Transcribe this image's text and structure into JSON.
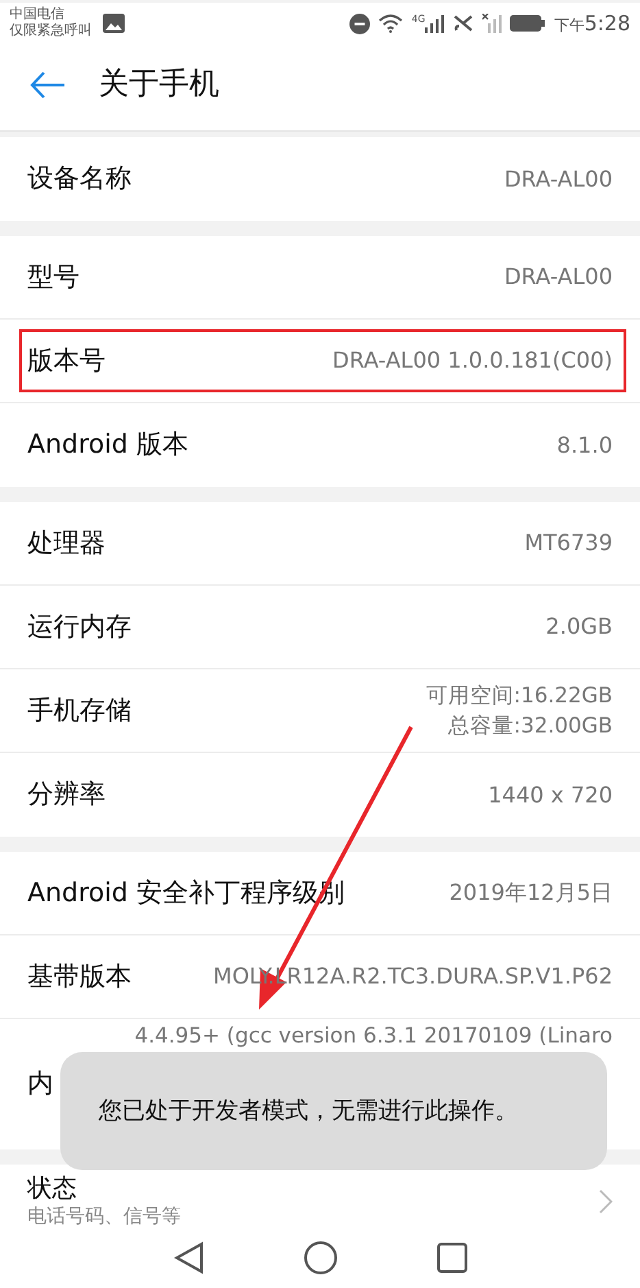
{
  "status_bar": {
    "carrier_lines": [
      "中国电信",
      "仅限紧急呼叫"
    ],
    "time_prefix": "下午",
    "time": "5:28",
    "network": "4G"
  },
  "header": {
    "title": "关于手机"
  },
  "sections": [
    {
      "rows": [
        {
          "kind": "info",
          "label": "设备名称",
          "values": [
            "DRA-AL00"
          ],
          "highlighted": false
        }
      ]
    },
    {
      "rows": [
        {
          "kind": "info",
          "label": "型号",
          "values": [
            "DRA-AL00"
          ],
          "highlighted": false
        },
        {
          "kind": "info",
          "label": "版本号",
          "values": [
            "DRA-AL00 1.0.0.181(C00)"
          ],
          "highlighted": true
        },
        {
          "kind": "info",
          "label": "Android 版本",
          "values": [
            "8.1.0"
          ],
          "highlighted": false
        }
      ]
    },
    {
      "rows": [
        {
          "kind": "info",
          "label": "处理器",
          "values": [
            "MT6739"
          ],
          "highlighted": false
        },
        {
          "kind": "info",
          "label": "运行内存",
          "values": [
            "2.0GB"
          ],
          "highlighted": false
        },
        {
          "kind": "info",
          "label": "手机存储",
          "values": [
            "可用空间:16.22GB",
            "总容量:32.00GB"
          ],
          "highlighted": false
        },
        {
          "kind": "info",
          "label": "分辨率",
          "values": [
            "1440 x 720"
          ],
          "highlighted": false
        }
      ]
    },
    {
      "rows": [
        {
          "kind": "info",
          "label": "Android 安全补丁程序级别",
          "values": [
            "2019年12月5日"
          ],
          "highlighted": false
        },
        {
          "kind": "info",
          "label": "基带版本",
          "values": [
            "MOLY.LR12A.R2.TC3.DURA.SP.V1.P62"
          ],
          "highlighted": false
        },
        {
          "kind": "partial",
          "label": "内",
          "values": [
            "4.4.95+ (gcc version 6.3.1 20170109 (Linaro"
          ],
          "highlighted": false
        }
      ]
    },
    {
      "rows": [
        {
          "kind": "link",
          "label": "状态",
          "subtitle": "电话号码、信号等"
        }
      ]
    }
  ],
  "toast": {
    "message": "您已处于开发者模式，无需进行此操作。"
  }
}
